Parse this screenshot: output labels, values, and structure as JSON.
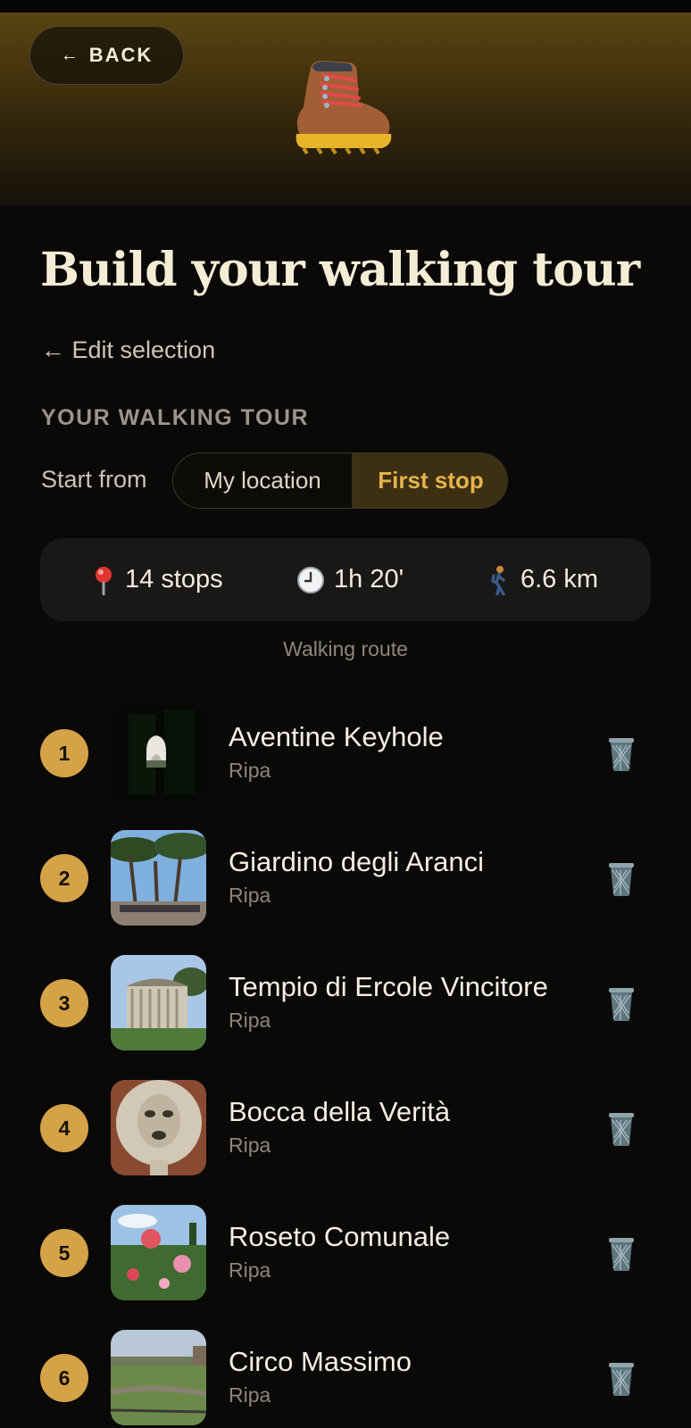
{
  "header": {
    "back_label": "BACK",
    "back_arrow": "←",
    "hero_icon": "hiking-boot-icon"
  },
  "page": {
    "title": "Build your walking tour",
    "edit_link": "← Edit selection",
    "section_label": "YOUR WALKING TOUR",
    "start_from_label": "Start from",
    "start_options": [
      "My location",
      "First stop"
    ],
    "start_selected": "First stop"
  },
  "stats": {
    "stops": "14 stops",
    "duration": "1h 20'",
    "distance": "6.6 km",
    "icons": [
      "pin-icon",
      "clock-icon",
      "walker-icon"
    ]
  },
  "route_caption": "Walking route",
  "stops": [
    {
      "number": "1",
      "name": "Aventine Keyhole",
      "area": "Ripa"
    },
    {
      "number": "2",
      "name": "Giardino degli Aranci",
      "area": "Ripa"
    },
    {
      "number": "3",
      "name": "Tempio di Ercole Vincitore",
      "area": "Ripa"
    },
    {
      "number": "4",
      "name": "Bocca della Verità",
      "area": "Ripa"
    },
    {
      "number": "5",
      "name": "Roseto Comunale",
      "area": "Ripa"
    },
    {
      "number": "6",
      "name": "Circo Massimo",
      "area": "Ripa"
    }
  ],
  "colors": {
    "accent": "#d4a247",
    "accent_text": "#e6b34c",
    "background": "#0a0908",
    "card": "#1a1816"
  }
}
